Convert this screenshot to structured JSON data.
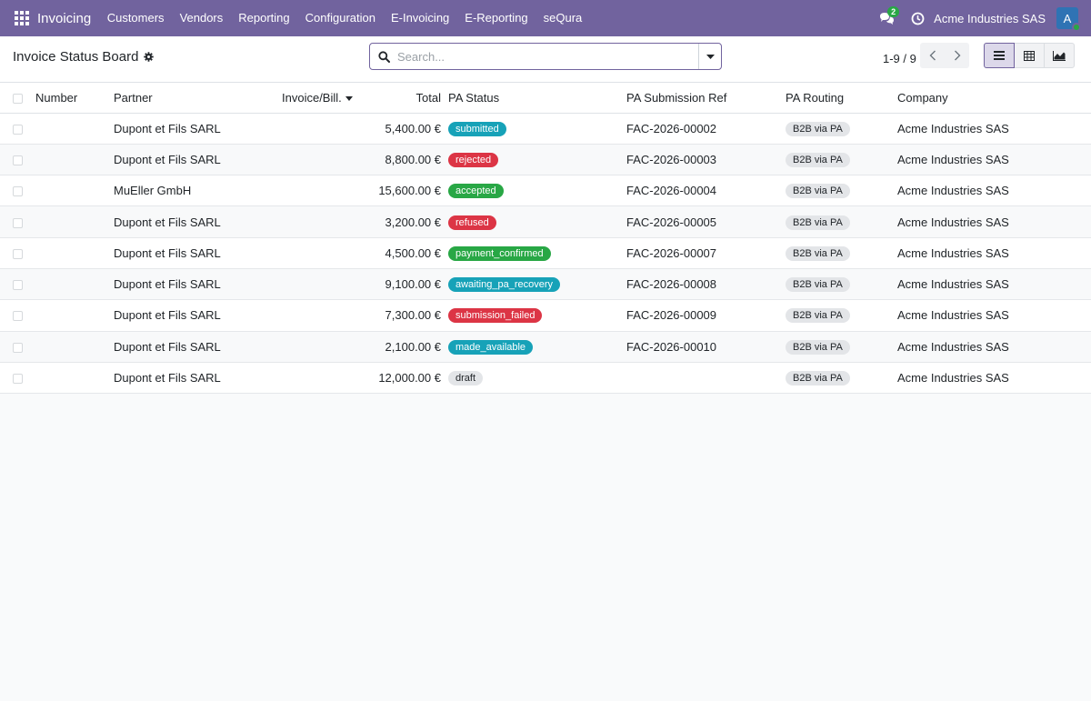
{
  "navbar": {
    "app_name": "Invoicing",
    "menu": [
      "Customers",
      "Vendors",
      "Reporting",
      "Configuration",
      "E-Invoicing",
      "E-Reporting",
      "seQura"
    ],
    "chat_badge": "2",
    "company": "Acme Industries SAS",
    "avatar_letter": "A",
    "bg_color": "#71639e"
  },
  "control_panel": {
    "title": "Invoice Status Board",
    "search_placeholder": "Search...",
    "pager": "1-9 / 9"
  },
  "table": {
    "headers": {
      "number": "Number",
      "partner": "Partner",
      "invoice_bill": "Invoice/Bill.",
      "total": "Total",
      "pa_status": "PA Status",
      "pa_ref": "PA Submission Ref",
      "pa_routing": "PA Routing",
      "company": "Company"
    },
    "rows": [
      {
        "number": "",
        "partner": "Dupont et Fils SARL",
        "invoice_bill": "",
        "total": "5,400.00 €",
        "status": "submitted",
        "status_color": "#17a2b8",
        "ref": "FAC-2026-00002",
        "routing": "B2B via PA",
        "company": "Acme Industries SAS"
      },
      {
        "number": "",
        "partner": "Dupont et Fils SARL",
        "invoice_bill": "",
        "total": "8,800.00 €",
        "status": "rejected",
        "status_color": "#dc3545",
        "ref": "FAC-2026-00003",
        "routing": "B2B via PA",
        "company": "Acme Industries SAS"
      },
      {
        "number": "",
        "partner": "MuEller GmbH",
        "invoice_bill": "",
        "total": "15,600.00 €",
        "status": "accepted",
        "status_color": "#28a745",
        "ref": "FAC-2026-00004",
        "routing": "B2B via PA",
        "company": "Acme Industries SAS"
      },
      {
        "number": "",
        "partner": "Dupont et Fils SARL",
        "invoice_bill": "",
        "total": "3,200.00 €",
        "status": "refused",
        "status_color": "#dc3545",
        "ref": "FAC-2026-00005",
        "routing": "B2B via PA",
        "company": "Acme Industries SAS"
      },
      {
        "number": "",
        "partner": "Dupont et Fils SARL",
        "invoice_bill": "",
        "total": "4,500.00 €",
        "status": "payment_confirmed",
        "status_color": "#28a745",
        "ref": "FAC-2026-00007",
        "routing": "B2B via PA",
        "company": "Acme Industries SAS"
      },
      {
        "number": "",
        "partner": "Dupont et Fils SARL",
        "invoice_bill": "",
        "total": "9,100.00 €",
        "status": "awaiting_pa_recovery",
        "status_color": "#17a2b8",
        "ref": "FAC-2026-00008",
        "routing": "B2B via PA",
        "company": "Acme Industries SAS"
      },
      {
        "number": "",
        "partner": "Dupont et Fils SARL",
        "invoice_bill": "",
        "total": "7,300.00 €",
        "status": "submission_failed",
        "status_color": "#dc3545",
        "ref": "FAC-2026-00009",
        "routing": "B2B via PA",
        "company": "Acme Industries SAS"
      },
      {
        "number": "",
        "partner": "Dupont et Fils SARL",
        "invoice_bill": "",
        "total": "2,100.00 €",
        "status": "made_available",
        "status_color": "#17a2b8",
        "ref": "FAC-2026-00010",
        "routing": "B2B via PA",
        "company": "Acme Industries SAS"
      },
      {
        "number": "",
        "partner": "Dupont et Fils SARL",
        "invoice_bill": "",
        "total": "12,000.00 €",
        "status": "draft",
        "status_color": "#e3e5e8",
        "ref": "",
        "routing": "B2B via PA",
        "company": "Acme Industries SAS"
      }
    ]
  },
  "icons": {
    "apps": "apps-grid-icon",
    "chat": "chat-icon",
    "clock": "clock-icon",
    "gear": "gear-icon",
    "search": "search-icon",
    "caret": "caret-down-icon",
    "prev": "chevron-left-icon",
    "next": "chevron-right-icon",
    "list_view": "list-view-icon",
    "pivot_view": "pivot-view-icon",
    "graph_view": "graph-view-icon"
  }
}
